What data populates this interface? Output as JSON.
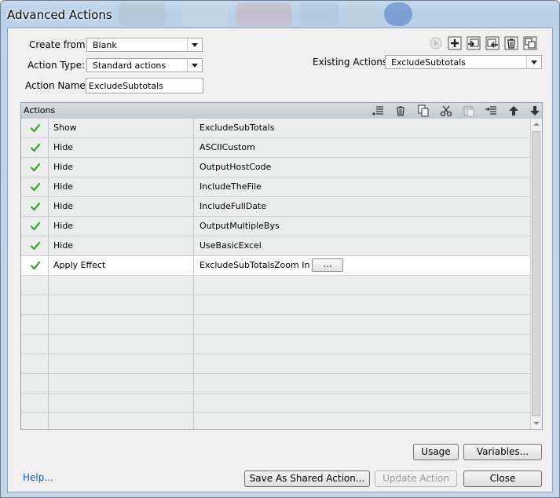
{
  "window": {
    "title": "Advanced Actions"
  },
  "form": {
    "create_from_label": "Create from:",
    "create_from_value": "Blank",
    "action_type_label": "Action Type:",
    "action_type_value": "Standard actions",
    "action_name_label": "Action Name:",
    "action_name_value": "ExcludeSubtotals",
    "existing_actions_label": "Existing Actions:",
    "existing_actions_value": "ExcludeSubtotals"
  },
  "toolbar_icons": [
    "play-icon",
    "add-icon",
    "import-icon",
    "export-icon",
    "delete-icon",
    "duplicate-icon"
  ],
  "grid": {
    "header": "Actions",
    "header_icons": [
      "insert-row-icon",
      "delete-row-icon",
      "copy-icon",
      "cut-icon",
      "paste-icon",
      "insert-below-icon",
      "move-up-icon",
      "move-down-icon"
    ],
    "rows": [
      {
        "action": "Show",
        "target": "ExcludeSubTotals",
        "extra": "",
        "checked": true
      },
      {
        "action": "Hide",
        "target": "ASCIICustom",
        "extra": "",
        "checked": true
      },
      {
        "action": "Hide",
        "target": "OutputHostCode",
        "extra": "",
        "checked": true
      },
      {
        "action": "Hide",
        "target": "IncludeTheFile",
        "extra": "",
        "checked": true
      },
      {
        "action": "Hide",
        "target": "IncludeFullDate",
        "extra": "",
        "checked": true
      },
      {
        "action": "Hide",
        "target": "OutputMultipleBys",
        "extra": "",
        "checked": true
      },
      {
        "action": "Hide",
        "target": "UseBasicExcel",
        "extra": "",
        "checked": true
      },
      {
        "action": "Apply Effect",
        "target": "ExcludeSubTotals",
        "extra": "Zoom In",
        "ellipsis": "...",
        "checked": true
      }
    ],
    "empty_rows": 8
  },
  "buttons": {
    "usage": "Usage",
    "variables": "Variables...",
    "save_shared": "Save As Shared Action...",
    "update": "Update Action",
    "close": "Close",
    "help": "Help..."
  },
  "colors": {
    "check": "#3aa52e",
    "link": "#1a5fb4"
  }
}
